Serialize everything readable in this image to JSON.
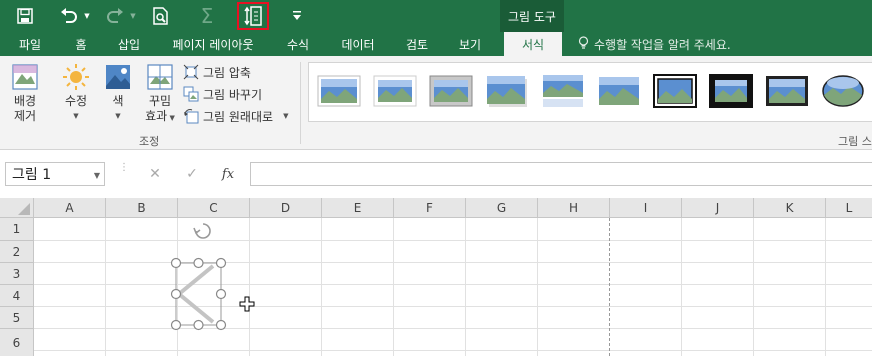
{
  "title_bar": {
    "contextual_tab_title": "그림 도구",
    "icons": [
      "save-icon",
      "undo-icon",
      "dropdown-icon",
      "redo-icon",
      "dropdown-icon",
      "print-preview-icon",
      "sum-icon",
      "size-with-cells-icon",
      "customize-qat-icon"
    ],
    "accent": "#217346",
    "highlight": "#e81123"
  },
  "tabs": [
    "파일",
    "홈",
    "삽입",
    "페이지 레이아웃",
    "수식",
    "데이터",
    "검토",
    "보기",
    "서식"
  ],
  "active_tab": "서식",
  "tell_me": "수행할 작업을 알려 주세요.",
  "ribbon": {
    "remove_background": [
      "배경",
      "제거"
    ],
    "corrections": "수정",
    "color": "색",
    "artistic_effects": [
      "꾸밈",
      "효과"
    ],
    "compress": "그림 압축",
    "change": "그림 바꾸기",
    "reset": "그림 원래대로",
    "adjust_group": "조정",
    "styles_group": "그림 스"
  },
  "formula_bar": {
    "name_box": "그림 1",
    "fx": "fx",
    "cancel": "✕",
    "enter": "✓",
    "value": ""
  },
  "columns": [
    "A",
    "B",
    "C",
    "D",
    "E",
    "F",
    "G",
    "H",
    "I",
    "J",
    "K",
    "L"
  ],
  "rows": [
    "1",
    "2",
    "3",
    "4",
    "5",
    "6"
  ]
}
